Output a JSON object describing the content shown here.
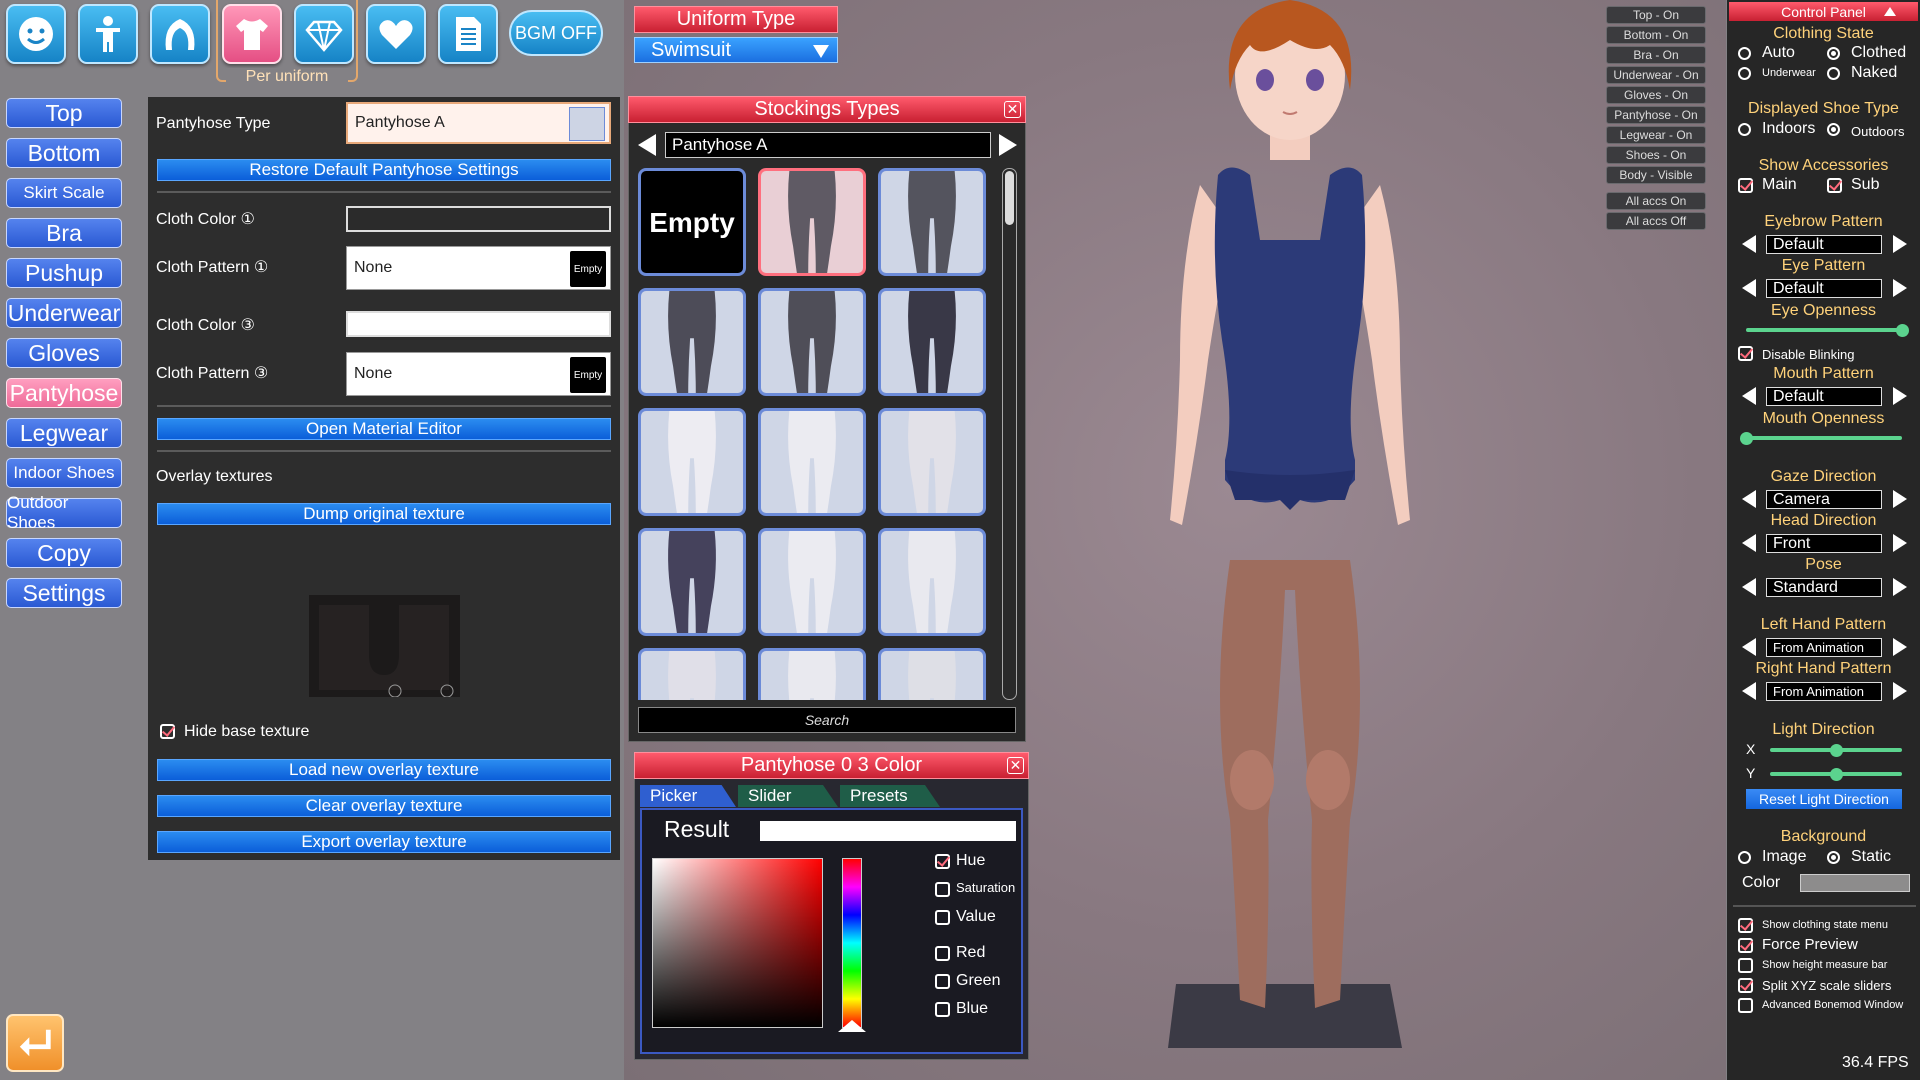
{
  "toolbar": {
    "bgm_label": "BGM OFF",
    "per_uniform": "Per uniform"
  },
  "uniform": {
    "title": "Uniform Type",
    "selected": "Swimsuit"
  },
  "categories": [
    "Top",
    "Bottom",
    "Skirt Scale",
    "Bra",
    "Pushup",
    "Underwear",
    "Gloves",
    "Pantyhose",
    "Legwear",
    "Indoor Shoes",
    "Outdoor Shoes",
    "Copy",
    "Settings"
  ],
  "settings_panel": {
    "type_label": "Pantyhose Type",
    "type_value": "Pantyhose A",
    "restore_button": "Restore Default Pantyhose Settings",
    "cloth_color_1": "Cloth Color ①",
    "cloth_pattern_1": "Cloth Pattern ①",
    "pattern_1_value": "None",
    "cloth_color_3": "Cloth Color ③",
    "cloth_pattern_3": "Cloth Pattern ③",
    "pattern_3_value": "None",
    "empty_mini": "Empty",
    "open_material": "Open Material Editor",
    "overlay_label": "Overlay textures",
    "dump_button": "Dump original texture",
    "hide_base": "Hide base texture",
    "load_overlay": "Load new overlay texture",
    "clear_overlay": "Clear overlay texture",
    "export_overlay": "Export overlay texture"
  },
  "stockings": {
    "title": "Stockings Types",
    "selected": "Pantyhose A",
    "empty_label": "Empty",
    "search_placeholder": "Search"
  },
  "color_window": {
    "title": "Pantyhose 0 3 Color",
    "tabs": [
      "Picker",
      "Slider",
      "Presets"
    ],
    "result_label": "Result",
    "options": [
      {
        "label": "Hue",
        "checked": true
      },
      {
        "label": "Saturation",
        "checked": false
      },
      {
        "label": "Value",
        "checked": false
      },
      {
        "label": "Red",
        "checked": false
      },
      {
        "label": "Green",
        "checked": false
      },
      {
        "label": "Blue",
        "checked": false
      }
    ]
  },
  "state_buttons": [
    "Top - On",
    "Bottom - On",
    "Bra - On",
    "Underwear - On",
    "Gloves - On",
    "Pantyhose - On",
    "Legwear - On",
    "Shoes - On",
    "Body - Visible",
    "All accs On",
    "All accs Off"
  ],
  "control_panel": {
    "header": "Control Panel",
    "clothing_state": "Clothing State",
    "auto": "Auto",
    "clothed": "Clothed",
    "underwear": "Underwear",
    "naked": "Naked",
    "shoe_type": "Displayed Shoe Type",
    "indoors": "Indoors",
    "outdoors": "Outdoors",
    "show_acc": "Show Accessories",
    "main": "Main",
    "sub": "Sub",
    "eyebrow_pattern": "Eyebrow Pattern",
    "eyebrow_value": "Default",
    "eye_pattern": "Eye Pattern",
    "eye_value": "Default",
    "eye_openness": "Eye Openness",
    "eye_openness_level": 1.0,
    "disable_blinking": "Disable Blinking",
    "mouth_pattern": "Mouth Pattern",
    "mouth_value": "Default",
    "mouth_openness": "Mouth Openness",
    "mouth_openness_level": 0.0,
    "gaze_direction": "Gaze Direction",
    "gaze_value": "Camera",
    "head_direction": "Head Direction",
    "head_value": "Front",
    "pose": "Pose",
    "pose_value": "Standard",
    "left_hand": "Left Hand Pattern",
    "left_hand_value": "From Animation",
    "right_hand": "Right Hand Pattern",
    "right_hand_value": "From Animation",
    "light_direction": "Light Direction",
    "light_x_label": "X",
    "light_y_label": "Y",
    "light_x": 0.5,
    "light_y": 0.5,
    "reset_light": "Reset Light Direction",
    "background": "Background",
    "image": "Image",
    "static": "Static",
    "color": "Color",
    "show_clothing_menu": "Show clothing state menu",
    "force_preview": "Force Preview",
    "height_bar": "Show height measure bar",
    "split_xyz": "Split XYZ scale sliders",
    "advanced_bonemod": "Advanced Bonemod Window",
    "fps": "36.4 FPS"
  },
  "colors": {
    "accent_blue": "#1b6fe0",
    "accent_pink": "#ee6a98",
    "window_red": "#c82032",
    "cp_title": "#ffd27a",
    "slider_green": "#5bd38e"
  }
}
